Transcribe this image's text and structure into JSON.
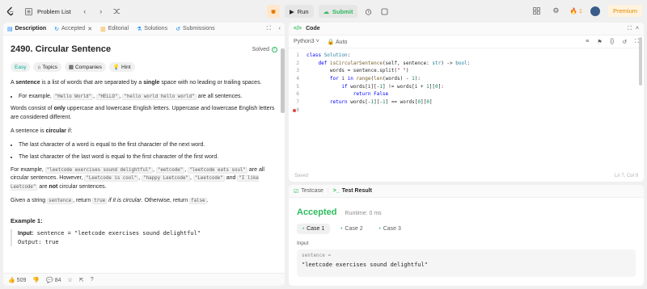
{
  "nav": {
    "problem_list": "Problem List",
    "run": "Run",
    "submit": "Submit",
    "streak": "1",
    "premium": "Premium"
  },
  "left_tabs": {
    "description": "Description",
    "accepted": "Accepted",
    "editorial": "Editorial",
    "solutions": "Solutions",
    "submissions": "Submissions"
  },
  "problem": {
    "title": "2490. Circular Sentence",
    "solved": "Solved",
    "difficulty": "Easy",
    "topics": "Topics",
    "companies": "Companies",
    "hint": "Hint"
  },
  "description": {
    "p1_a": "A ",
    "p1_b": "sentence",
    "p1_c": " is a list of words that are separated by a ",
    "p1_d": "single",
    "p1_e": " space with no leading or trailing spaces.",
    "b1_a": "For example, ",
    "b1_c1": "\"Hello World\"",
    "b1_sep1": ", ",
    "b1_c2": "\"HELLO\"",
    "b1_sep2": ", ",
    "b1_c3": "\"hello world hello world\"",
    "b1_b": " are all sentences.",
    "p2_a": "Words consist of ",
    "p2_b": "only",
    "p2_c": " uppercase and lowercase English letters. Uppercase and lowercase English letters are considered different.",
    "p3_a": "A sentence is ",
    "p3_b": "circular",
    "p3_c": " if:",
    "b2": "The last character of a word is equal to the first character of the next word.",
    "b3": "The last character of the last word is equal to the first character of the first word.",
    "p4_a": "For example, ",
    "p4_c1": "\"leetcode exercises sound delightful\"",
    "p4_s1": ", ",
    "p4_c2": "\"eetcode\"",
    "p4_s2": ", ",
    "p4_c3": "\"leetcode eats soul\"",
    "p4_b": " are all circular sentences. However, ",
    "p4_c4": "\"Leetcode is cool\"",
    "p4_s3": ", ",
    "p4_c5": "\"happy Leetcode\"",
    "p4_s4": ", ",
    "p4_c6": "\"Leetcode\"",
    "p4_s5": " and ",
    "p4_c7": "\"I like Leetcode\"",
    "p4_s6": " are ",
    "p4_not": "not",
    "p4_end": " circular sentences.",
    "p5_a": "Given a string ",
    "p5_c1": "sentence",
    "p5_b": ", return ",
    "p5_c2": "true",
    "p5_i": " if it is circular",
    "p5_c": ". Otherwise, return ",
    "p5_c3": "false",
    "p5_d": ".",
    "example_title": "Example 1:",
    "ex_input_lbl": "Input:",
    "ex_input_val": " sentence = \"leetcode exercises sound delightful\"",
    "ex_output": "Output: true"
  },
  "bottom_bar": {
    "likes": "509",
    "comments": "84"
  },
  "code_panel": {
    "label": "Code",
    "language": "Python3",
    "auto": "Auto",
    "saved": "Saved",
    "cursor": "Ln 7, Col 9"
  },
  "code_lines": [
    {
      "n": "1",
      "tokens": [
        [
          "kw",
          "class "
        ],
        [
          "ty",
          "Solution"
        ],
        [
          "pl",
          ":"
        ]
      ]
    },
    {
      "n": "2",
      "tokens": [
        [
          "pl",
          "    "
        ],
        [
          "kw",
          "def "
        ],
        [
          "fn",
          "isCircularSentence"
        ],
        [
          "pl",
          "(self, sentence: "
        ],
        [
          "ty",
          "str"
        ],
        [
          "pl",
          ") -> "
        ],
        [
          "ty",
          "bool"
        ],
        [
          "pl",
          ":"
        ]
      ]
    },
    {
      "n": "3",
      "tokens": [
        [
          "pl",
          "        words = sentence.split("
        ],
        [
          "str",
          "\" \""
        ],
        [
          "pl",
          ")"
        ]
      ]
    },
    {
      "n": "4",
      "tokens": [
        [
          "pl",
          "        "
        ],
        [
          "kw",
          "for "
        ],
        [
          "pl",
          "i "
        ],
        [
          "kw",
          "in "
        ],
        [
          "fn",
          "range"
        ],
        [
          "pl",
          "("
        ],
        [
          "fn",
          "len"
        ],
        [
          "pl",
          "(words) - "
        ],
        [
          "num",
          "1"
        ],
        [
          "pl",
          "):"
        ]
      ]
    },
    {
      "n": "5",
      "tokens": [
        [
          "pl",
          "            "
        ],
        [
          "kw",
          "if "
        ],
        [
          "pl",
          "words[i][-"
        ],
        [
          "num",
          "1"
        ],
        [
          "pl",
          "] != words[i + "
        ],
        [
          "num",
          "1"
        ],
        [
          "pl",
          "]["
        ],
        [
          "num",
          "0"
        ],
        [
          "pl",
          "]:"
        ]
      ]
    },
    {
      "n": "6",
      "tokens": [
        [
          "pl",
          "                "
        ],
        [
          "kw",
          "return "
        ],
        [
          "kw",
          "False"
        ]
      ]
    },
    {
      "n": "7",
      "tokens": [
        [
          "pl",
          "        "
        ],
        [
          "kw",
          "return "
        ],
        [
          "pl",
          "words[-"
        ],
        [
          "num",
          "1"
        ],
        [
          "pl",
          "][-"
        ],
        [
          "num",
          "1"
        ],
        [
          "pl",
          "] == words["
        ],
        [
          "num",
          "0"
        ],
        [
          "pl",
          "]["
        ],
        [
          "num",
          "0"
        ],
        [
          "pl",
          "]"
        ]
      ]
    },
    {
      "n": "8",
      "tokens": []
    }
  ],
  "result_panel": {
    "testcase_tab": "Testcase",
    "result_tab": "Test Result",
    "status": "Accepted",
    "runtime": "Runtime: 0 ms",
    "cases": [
      "Case 1",
      "Case 2",
      "Case 3"
    ],
    "input_label": "Input",
    "input_key": "sentence =",
    "input_value": "\"leetcode exercises sound delightful\""
  },
  "colors": {
    "accent_green": "#2cbb5d",
    "easy": "#00af9b",
    "streak_orange": "#ffa116"
  }
}
